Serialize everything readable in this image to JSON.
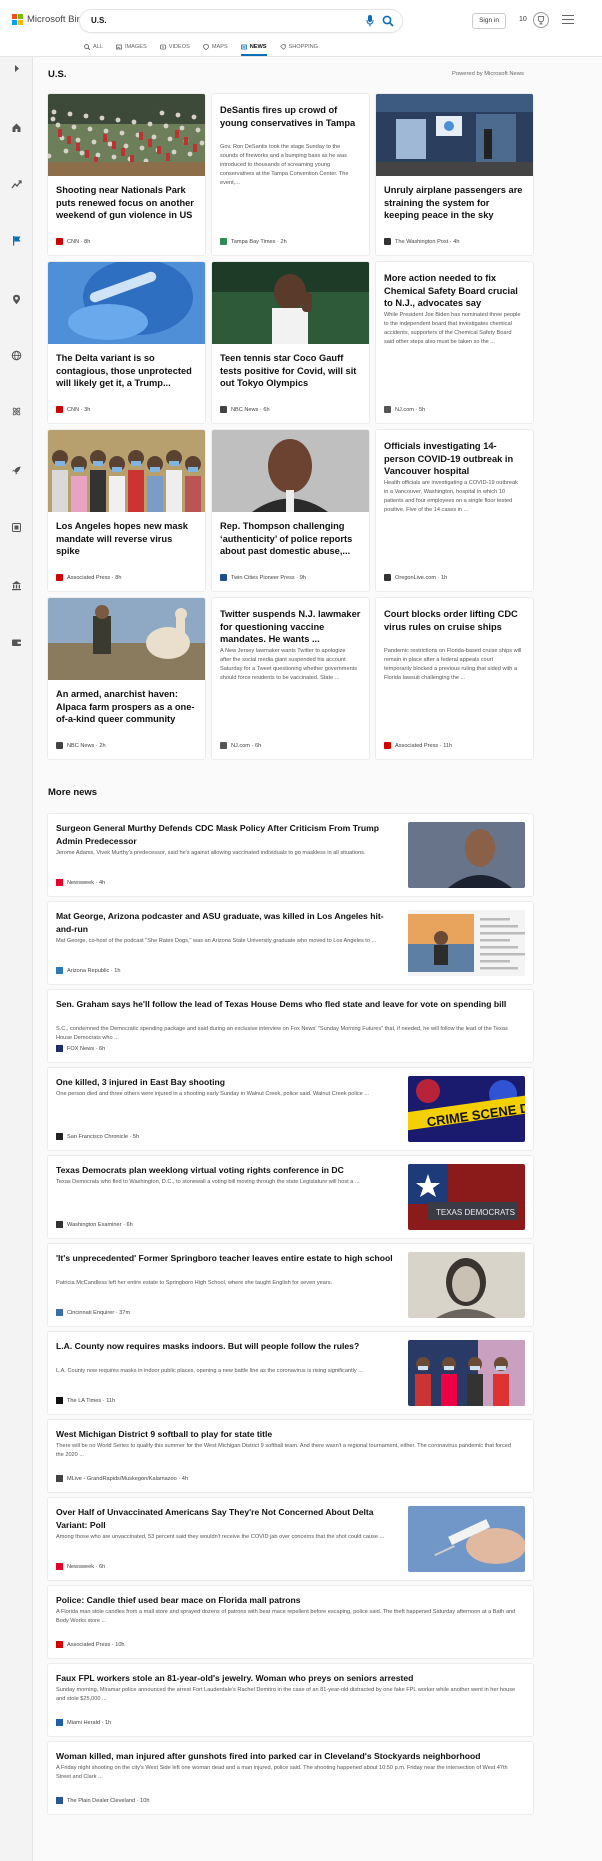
{
  "header": {
    "brand": "Microsoft Bing",
    "query": "U.S.",
    "sign_in": "Sign in",
    "rewards_count": "10",
    "logo_colors": [
      "#f25022",
      "#7fba00",
      "#00a4ef",
      "#ffb900"
    ],
    "accent": "#0e6fb7"
  },
  "tabs": [
    {
      "label": "ALL",
      "icon": "search-icon"
    },
    {
      "label": "IMAGES",
      "icon": "image-icon"
    },
    {
      "label": "VIDEOS",
      "icon": "video-icon"
    },
    {
      "label": "MAPS",
      "icon": "map-pin-icon"
    },
    {
      "label": "NEWS",
      "icon": "news-icon",
      "active": true
    },
    {
      "label": "SHOPPING",
      "icon": "shopping-tag-icon"
    }
  ],
  "sidebar": [
    {
      "name": "sidebar-expand",
      "icon": "chevron-right-icon"
    },
    {
      "name": "sidebar-home",
      "icon": "home-icon"
    },
    {
      "name": "sidebar-trending",
      "icon": "trending-icon"
    },
    {
      "name": "sidebar-us",
      "icon": "flag-icon",
      "active": true
    },
    {
      "name": "sidebar-local",
      "icon": "location-icon"
    },
    {
      "name": "sidebar-world",
      "icon": "globe-icon"
    },
    {
      "name": "sidebar-science",
      "icon": "atom-icon"
    },
    {
      "name": "sidebar-tech",
      "icon": "rocket-icon"
    },
    {
      "name": "sidebar-entertainment",
      "icon": "film-icon"
    },
    {
      "name": "sidebar-politics",
      "icon": "building-icon"
    },
    {
      "name": "sidebar-business",
      "icon": "wallet-icon"
    }
  ],
  "main": {
    "section_title": "U.S.",
    "powered_by": "Powered by Microsoft News",
    "more_title": "More news"
  },
  "cards": [
    {
      "title": "Shooting near Nationals Park puts renewed focus on another weekend of gun violence in US",
      "source": "CNN",
      "time": "8h",
      "logo_color": "#cc0000",
      "image": "baseball-stadium-crowd"
    },
    {
      "title": "DeSantis fires up crowd of young conservatives in Tampa",
      "desc": "Gov. Ron DeSantis took the stage Sunday to the sounds of fireworks and a bumping bass as he was introduced to thousands of screaming young conservatives at the Tampa Convention Center. The event,...",
      "source": "Tampa Bay Times",
      "time": "2h",
      "logo_color": "#2e8b57"
    },
    {
      "title": "Unruly airplane passengers are straining the system for keeping peace in the sky",
      "source": "The Washington Post",
      "time": "4h",
      "logo_color": "#333333",
      "image": "airport-terminal"
    },
    {
      "title": "The Delta variant is so contagious, those unprotected will likely get it, a Trump...",
      "source": "CNN",
      "time": "3h",
      "logo_color": "#cc0000",
      "image": "vaccine-gloves"
    },
    {
      "title": "Teen tennis star Coco Gauff tests positive for Covid, will sit out Tokyo Olympics",
      "source": "NBC News",
      "time": "6h",
      "logo_color": "#444444",
      "image": "tennis-player"
    },
    {
      "title": "More action needed to fix Chemical Safety Board crucial to N.J., advocates say",
      "desc": "While President Joe Biden has nominated three people to the independent board that investigates chemical accidents, supporters of the Chemical Safety Board said other steps also must be taken so the ...",
      "source": "NJ.com",
      "time": "5h",
      "logo_color": "#555555"
    },
    {
      "title": "Los Angeles hopes new mask mandate will reverse virus spike",
      "source": "Associated Press",
      "time": "8h",
      "logo_color": "#d40000",
      "image": "masked-crowd"
    },
    {
      "title": "Rep. Thompson challenging ‘authenticity’ of police reports about past domestic abuse,...",
      "source": "Twin Cities Pioneer Press",
      "time": "9h",
      "logo_color": "#1f4e8c",
      "image": "portrait-man"
    },
    {
      "title": "Officials investigating 14-person COVID-19 outbreak in Vancouver hospital",
      "desc": "Health officials are investigating a COVID-19 outbreak in a Vancouver, Washington, hospital in which 10 patients and four employees on a single floor tested positive. Five of the 14 cases in ...",
      "source": "OregonLive.com",
      "time": "1h",
      "logo_color": "#333333"
    },
    {
      "title": "An armed, anarchist haven: Alpaca farm prospers as a one-of-a-kind queer community",
      "source": "NBC News",
      "time": "2h",
      "logo_color": "#444444",
      "image": "alpaca-farm"
    },
    {
      "title": "Twitter suspends N.J. lawmaker for questioning vaccine mandates. He wants ...",
      "desc": "A New Jersey lawmaker wants Twitter to apologize after the social media giant suspended his account Saturday for a Tweet questioning whether governments should force residents to be vaccinated. State ...",
      "source": "NJ.com",
      "time": "6h",
      "logo_color": "#555555"
    },
    {
      "title": "Court blocks order lifting CDC virus rules on cruise ships",
      "desc": "Pandemic restrictions on Florida-based cruise ships will remain in place after a federal appeals court temporarily blocked a previous ruling that sided with a Florida lawsuit challenging the ...",
      "source": "Associated Press",
      "time": "11h",
      "logo_color": "#d40000"
    }
  ],
  "rows": [
    {
      "title": "Surgeon General Murthy Defends CDC Mask Policy After Criticism From Trump Admin Predecessor",
      "desc": "Jerome Adams, Vivek Murthy's predecessor, said he's against allowing vaccinated individuals to go maskless in all situations.",
      "source": "Newsweek",
      "time": "4h",
      "logo_color": "#e4002b",
      "image": "portrait-surgeon-general"
    },
    {
      "title": "Mat George, Arizona podcaster and ASU graduate, was killed in Los Angeles hit-and-run",
      "desc": "Mat George, co-host of the podcast \"She Rates Dogs,\" was an Arizona State University graduate who moved to Los Angeles to ...",
      "source": "Arizona Republic",
      "time": "1h",
      "logo_color": "#2a7ab8",
      "image": "social-post-beach"
    },
    {
      "title": "Sen. Graham says he'll follow the lead of Texas House Dems who fled state and leave for vote on spending bill",
      "desc": "S.C., condemned the Democratic spending package and said during an exclusive interview on Fox News' \"Sunday Morning Futures\" that, if needed, he will follow the lead of the Texas House Democrats who ...",
      "source": "FOX News",
      "time": "6h",
      "logo_color": "#1c2f6b"
    },
    {
      "title": "One killed, 3 injured in East Bay shooting",
      "desc": "One person died and three others were injured in a shooting early Sunday in Walnut Creek, police said. Walnut Creek police ...",
      "source": "San Francisco Chronicle",
      "time": "5h",
      "logo_color": "#222222",
      "image": "crime-scene-tape"
    },
    {
      "title": "Texas Democrats plan weeklong virtual voting rights conference in DC",
      "desc": "Texas Democrats who fled to Washington, D.C., to stonewall a voting bill moving through the state Legislature will host a ...",
      "source": "Washington Examiner",
      "time": "6h",
      "logo_color": "#333333",
      "image": "texas-democrats-sign",
      "image_text": "TEXAS DEMOCRATS"
    },
    {
      "title": "'It's unprecedented' Former Springboro teacher leaves entire estate to high school",
      "desc": "Patricia McCandless left her entire estate to Springboro High School, where she taught English for seven years.",
      "source": "Cincinnati Enquirer",
      "time": "37m",
      "logo_color": "#3a6ea5",
      "image": "vintage-portrait"
    },
    {
      "title": "L.A. County now requires masks indoors. But will people follow the rules?",
      "desc": "L.A. County now requires masks in indoor public places, opening a new battle line as the coronavirus is rising significantly ...",
      "source": "The LA Times",
      "time": "11h",
      "logo_color": "#111111",
      "image": "masked-shoppers"
    },
    {
      "title": "West Michigan District 9 softball to play for state title",
      "desc": "There will be no World Series to qualify this summer for the West Michigan District 9 softball team. And there wasn't a regional tournament, either. The coronavirus pandemic that forced the 2020 ...",
      "source": "MLive - GrandRapids/Muskegon/Kalamazoo",
      "time": "4h",
      "logo_color": "#444444"
    },
    {
      "title": "Over Half of Unvaccinated Americans Say They're Not Concerned About Delta Variant: Poll",
      "desc": "Among those who are unvaccinated, 53 percent said they wouldn't receive the COVID jab over concerns that the shot could cause ...",
      "source": "Newsweek",
      "time": "6h",
      "logo_color": "#e4002b",
      "image": "vaccine-syringe"
    },
    {
      "title": "Police: Candle thief used bear mace on Florida mall patrons",
      "desc": "A Florida man stole candles from a mall store and sprayed dozens of patrons with bear mace repellent before escaping, police said. The theft happened Saturday afternoon at a Bath and Body Works store ...",
      "source": "Associated Press",
      "time": "10h",
      "logo_color": "#d40000"
    },
    {
      "title": "Faux FPL workers stole an 81-year-old's jewelry. Woman who preys on seniors arrested",
      "desc": "Sunday morning, Miramar police announced the arrest Fort Lauderdale's Rachel Demitro in the case of an 81-year-old distracted by one fake FPL worker while another went in her house and stole $25,000 ...",
      "source": "Miami Herald",
      "time": "1h",
      "logo_color": "#1d5fa8"
    },
    {
      "title": "Woman killed, man injured after gunshots fired into parked car in Cleveland's Stockyards neighborhood",
      "desc": "A Friday night shooting on the city's West Side left one woman dead and a man injured, police said. The shooting happened about 10:50 p.m. Friday near the intersection of West 47th Street and Clark ...",
      "source": "The Plain Dealer Cleveland",
      "time": "10h",
      "logo_color": "#2b5797"
    }
  ]
}
